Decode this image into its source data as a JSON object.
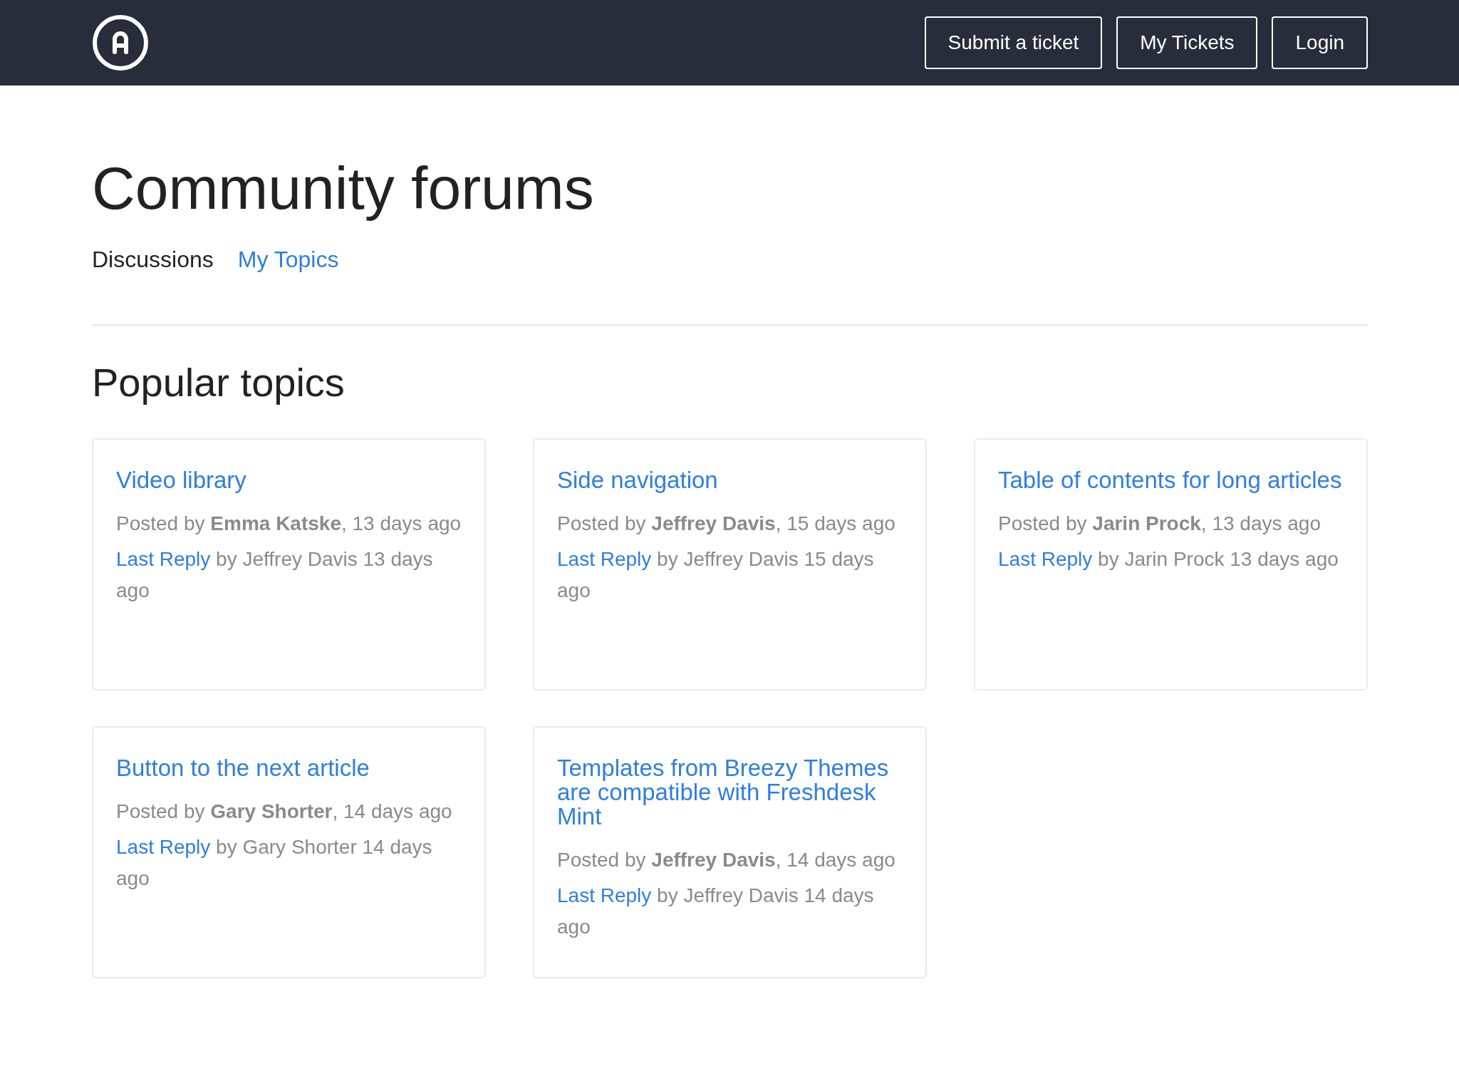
{
  "header": {
    "buttons": [
      {
        "label": "Submit a ticket"
      },
      {
        "label": "My Tickets"
      },
      {
        "label": "Login"
      }
    ]
  },
  "page": {
    "title": "Community forums",
    "tabs": [
      {
        "label": "Discussions",
        "selected": true
      },
      {
        "label": "My Topics",
        "selected": false
      }
    ]
  },
  "popular_topics": {
    "heading": "Popular topics",
    "topics": [
      {
        "title": "Video library",
        "posted": "Posted by **Emma Katske**, 13 days ago",
        "reply_link": "Last Reply",
        "reply_text": "by Jeffrey Davis 13 days ago"
      },
      {
        "title": "Side navigation",
        "posted": "Posted by **Jeffrey Davis**, 15 days ago",
        "reply_link": "Last Reply",
        "reply_text": "by Jeffrey Davis 15 days ago"
      },
      {
        "title": "Table of contents for long articles",
        "posted": "Posted by **Jarin Prock**, 13 days ago",
        "reply_link": "Last Reply",
        "reply_text": "by Jarin Prock 13 days ago"
      },
      {
        "title": "Button to the next article",
        "posted": "Posted by **Gary Shorter**, 14 days ago",
        "reply_link": "Last Reply",
        "reply_text": "by Gary Shorter 14 days ago"
      },
      {
        "title": "Templates from Breezy Themes are compatible with Freshdesk Mint",
        "posted": "Posted by **Jeffrey Davis**, 14 days ago",
        "reply_link": "Last Reply",
        "reply_text": "by Jeffrey Davis 14 days ago"
      }
    ]
  }
}
